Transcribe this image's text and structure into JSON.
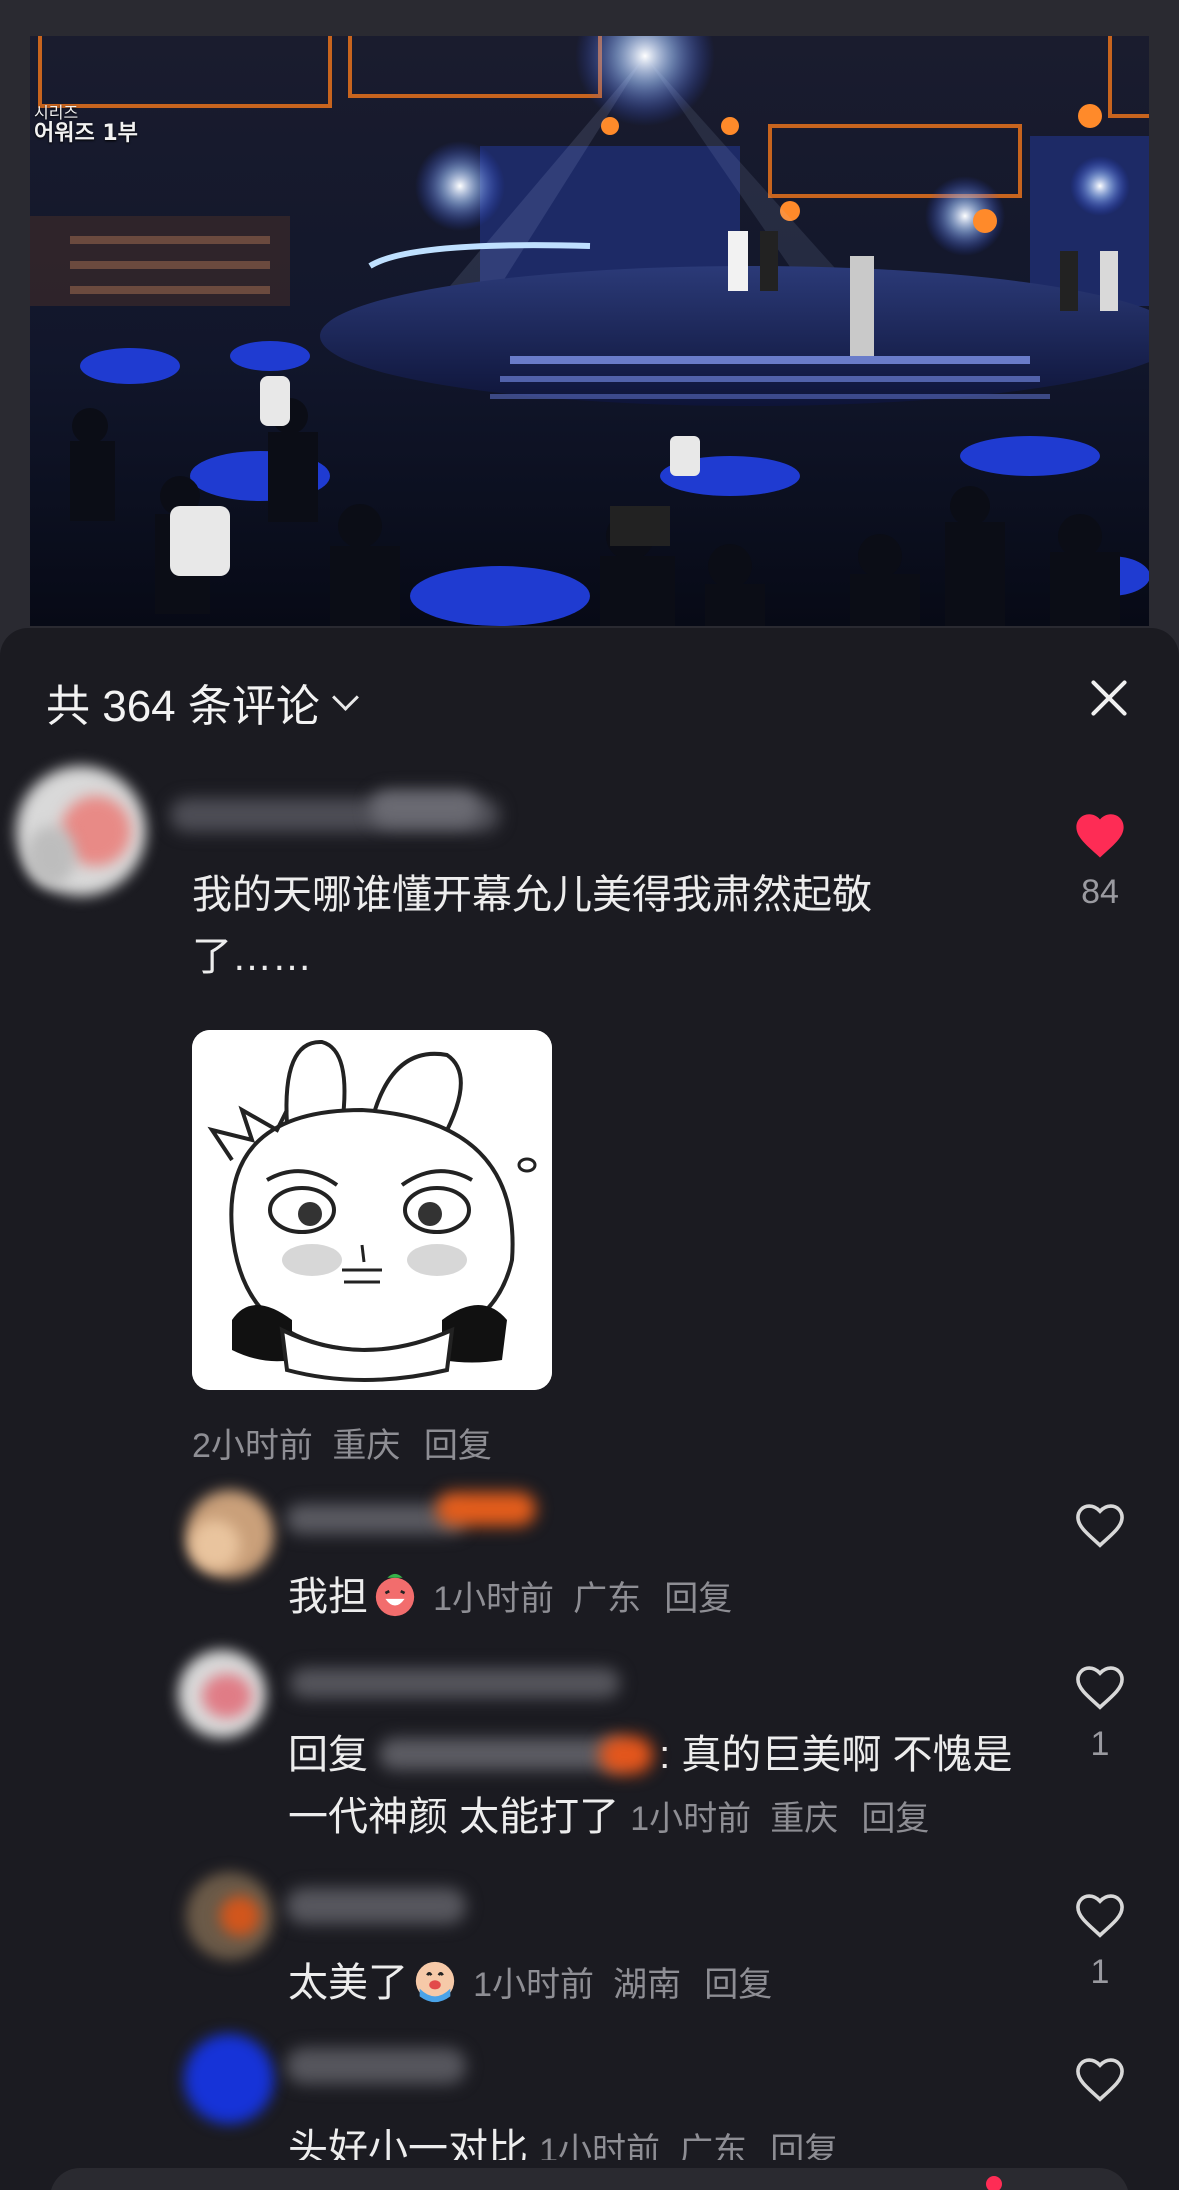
{
  "video": {
    "caption_line1": "시리즈",
    "caption_line2": "어워즈 1부"
  },
  "header": {
    "comment_count_label": "共 364 条评论"
  },
  "comments": [
    {
      "text": "我的天哪谁懂开幕允儿美得我肃然起敬了……",
      "text_line1": "我的天哪谁懂开幕允儿美得我肃然起敬",
      "text_line2": "了……",
      "time": "2小时前",
      "location": "重庆",
      "reply_label": "回复",
      "likes": "84",
      "liked": true
    }
  ],
  "replies": [
    {
      "text": "我担",
      "emoji": "laughing-face-emoji",
      "time": "1小时前",
      "location": "广东",
      "reply_label": "回复",
      "likes": ""
    },
    {
      "prefix": "回复",
      "text_line1_end": ": 真的巨美啊 不愧是",
      "text_line2": "一代神颜 太能打了",
      "time": "1小时前",
      "location": "重庆",
      "reply_label": "回复",
      "likes": "1"
    },
    {
      "text": "太美了",
      "emoji": "crying-face-emoji",
      "time": "1小时前",
      "location": "湖南",
      "reply_label": "回复",
      "likes": "1"
    },
    {
      "text": "头好小一对比",
      "time": "1小时前",
      "location": "广东",
      "reply_label": "回复",
      "likes": ""
    }
  ],
  "colors": {
    "liked_heart": "#fe2c55",
    "sheet_bg": "#1b1b21",
    "meta_text": "#8e8e94"
  }
}
